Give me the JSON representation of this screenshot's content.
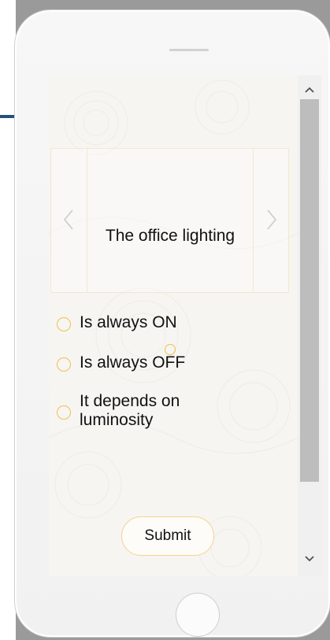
{
  "question": "The office lighting",
  "options": [
    {
      "label": "Is always ON"
    },
    {
      "label": "Is always OFF"
    },
    {
      "label": "It depends on luminosity"
    }
  ],
  "submit_label": "Submit",
  "colors": {
    "accent": "#efc24a",
    "outer_background": "#9a9a9a",
    "left_accent_line": "#24507e"
  },
  "icons": {
    "prev": "chevron-left-icon",
    "next": "chevron-right-icon",
    "scroll_up": "chevron-up-icon",
    "scroll_down": "chevron-down-icon"
  }
}
